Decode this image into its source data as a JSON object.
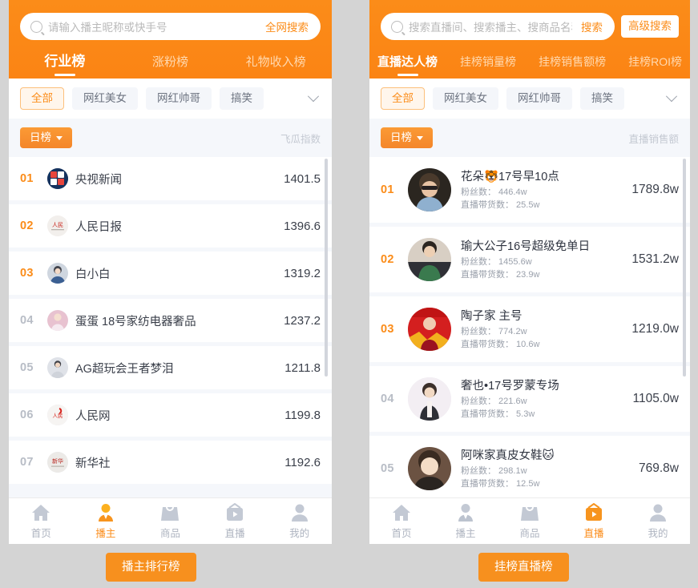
{
  "colors": {
    "brand_orange": "#fb8c19",
    "chip_active_bg": "#fff6ec",
    "panel_bg": "#f5f7fb",
    "page_bg": "#d4d4d4"
  },
  "left_panel": {
    "search": {
      "placeholder": "请输入播主昵称或快手号",
      "button_label": "全网搜索",
      "icon": "search-icon"
    },
    "tabs": [
      {
        "label": "行业榜",
        "active": true
      },
      {
        "label": "涨粉榜",
        "active": false
      },
      {
        "label": "礼物收入榜",
        "active": false
      }
    ],
    "chips": [
      {
        "label": "全部",
        "active": true
      },
      {
        "label": "网红美女",
        "active": false
      },
      {
        "label": "网红帅哥",
        "active": false
      },
      {
        "label": "搞笑",
        "active": false
      }
    ],
    "chips_more_icon": "chevron-down-icon",
    "sort": {
      "label": "日榜",
      "icon": "caret-down-icon"
    },
    "metric_label": "飞瓜指数",
    "rows": [
      {
        "rank": "01",
        "name": "央视新闻",
        "value": "1401.5"
      },
      {
        "rank": "02",
        "name": "人民日报",
        "value": "1396.6"
      },
      {
        "rank": "03",
        "name": "白小白",
        "value": "1319.2"
      },
      {
        "rank": "04",
        "name": "蛋蛋 18号家纺电器奢品",
        "value": "1237.2"
      },
      {
        "rank": "05",
        "name": "AG超玩会王者梦泪",
        "value": "1211.8"
      },
      {
        "rank": "06",
        "name": "人民网",
        "value": "1199.8"
      },
      {
        "rank": "07",
        "name": "新华社",
        "value": "1192.6"
      }
    ],
    "nav": [
      {
        "label": "首页",
        "icon": "home-icon",
        "active": false
      },
      {
        "label": "播主",
        "icon": "anchor-person-icon",
        "active": true
      },
      {
        "label": "商品",
        "icon": "shopping-bag-icon",
        "active": false
      },
      {
        "label": "直播",
        "icon": "tv-play-icon",
        "active": false
      },
      {
        "label": "我的",
        "icon": "user-profile-icon",
        "active": false
      }
    ],
    "caption": "播主排行榜"
  },
  "right_panel": {
    "search": {
      "placeholder": "搜索直播间、搜索播主、搜商品名称",
      "button_label": "搜索",
      "advanced_label": "高级搜索",
      "icon": "search-icon"
    },
    "tabs": [
      {
        "label": "直播达人榜",
        "active": true
      },
      {
        "label": "挂榜销量榜",
        "active": false
      },
      {
        "label": "挂榜销售额榜",
        "active": false
      },
      {
        "label": "挂榜ROI榜",
        "active": false
      }
    ],
    "chips": [
      {
        "label": "全部",
        "active": true
      },
      {
        "label": "网红美女",
        "active": false
      },
      {
        "label": "网红帅哥",
        "active": false
      },
      {
        "label": "搞笑",
        "active": false
      }
    ],
    "chips_more_icon": "chevron-down-icon",
    "sort": {
      "label": "日榜",
      "icon": "caret-down-icon"
    },
    "metric_label": "直播销售额",
    "rows": [
      {
        "rank": "01",
        "name": "花朵🐯17号早10点",
        "fans": "粉丝数： 446.4w",
        "goods": "直播带货数： 25.5w",
        "value": "1789.8w"
      },
      {
        "rank": "02",
        "name": "瑜大公子16号超级免单日",
        "fans": "粉丝数： 1455.6w",
        "goods": "直播带货数： 23.9w",
        "value": "1531.2w"
      },
      {
        "rank": "03",
        "name": "陶子家 主号",
        "fans": "粉丝数： 774.2w",
        "goods": "直播带货数： 10.6w",
        "value": "1219.0w"
      },
      {
        "rank": "04",
        "name": "奢也•17号罗蒙专场",
        "fans": "粉丝数： 221.6w",
        "goods": "直播带货数： 5.3w",
        "value": "1105.0w"
      },
      {
        "rank": "05",
        "name": "阿咪家真皮女鞋🐱",
        "fans": "粉丝数： 298.1w",
        "goods": "直播带货数： 12.5w",
        "value": "769.8w"
      }
    ],
    "nav": [
      {
        "label": "首页",
        "icon": "home-icon",
        "active": false
      },
      {
        "label": "播主",
        "icon": "anchor-person-icon",
        "active": false
      },
      {
        "label": "商品",
        "icon": "shopping-bag-icon",
        "active": false
      },
      {
        "label": "直播",
        "icon": "tv-play-icon",
        "active": true
      },
      {
        "label": "我的",
        "icon": "user-profile-icon",
        "active": false
      }
    ],
    "caption": "挂榜直播榜"
  }
}
